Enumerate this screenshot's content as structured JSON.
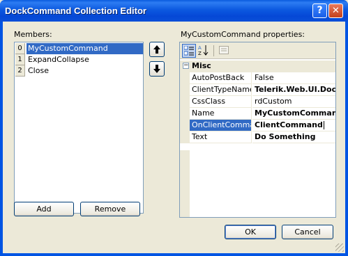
{
  "window": {
    "title": "DockCommand Collection Editor",
    "help_label": "?",
    "close_label": "✕"
  },
  "members": {
    "label": "Members:",
    "items": [
      {
        "index": "0",
        "name": "MyCustomCommand",
        "selected": true
      },
      {
        "index": "1",
        "name": "ExpandCollapse",
        "selected": false
      },
      {
        "index": "2",
        "name": "Close",
        "selected": false
      }
    ],
    "move_up_icon": "up-arrow-icon",
    "move_down_icon": "down-arrow-icon",
    "add_label": "Add",
    "remove_label": "Remove"
  },
  "properties": {
    "label": "MyCustomCommand properties:",
    "toolbar": {
      "categorized_icon": "categorized-icon",
      "alphabetical_icon": "alphabetical-icon",
      "property_pages_icon": "property-pages-icon"
    },
    "category": {
      "toggle": "−",
      "name": "Misc"
    },
    "rows": [
      {
        "name": "AutoPostBack",
        "value": "False",
        "bold": false
      },
      {
        "name": "ClientTypeName",
        "value": "Telerik.Web.UI.Dock",
        "bold": true
      },
      {
        "name": "CssClass",
        "value": "rdCustom",
        "bold": false
      },
      {
        "name": "Name",
        "value": "MyCustomCommand",
        "bold": true
      },
      {
        "name": "OnClientCommand",
        "value": "ClientCommand",
        "bold": true
      },
      {
        "name": "Text",
        "value": "Do Something",
        "bold": true
      }
    ]
  },
  "footer": {
    "ok_label": "OK",
    "cancel_label": "Cancel"
  }
}
